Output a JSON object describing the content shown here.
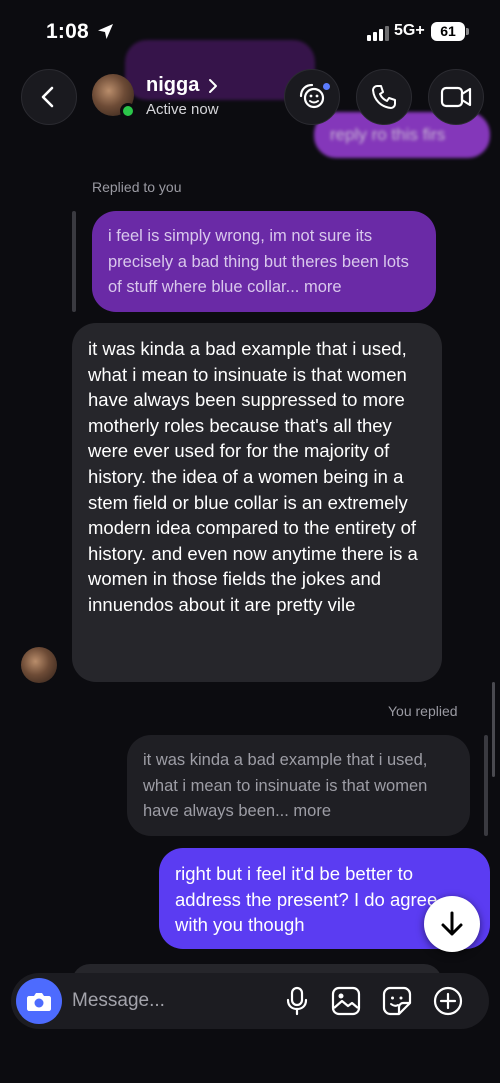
{
  "status_bar": {
    "time": "1:08",
    "network": "5G+",
    "battery": "61"
  },
  "header": {
    "contact_name": "nigga",
    "status": "Active now"
  },
  "background_preview": {
    "blurred_text": "reply ro this firs"
  },
  "messages": {
    "replied_to_you_label": "Replied to you",
    "quoted_from_me": "i feel is simply wrong, im not sure its precisely a bad thing but theres been lots of stuff where blue collar... more",
    "incoming": "it was kinda a bad example that i used, what i mean to insinuate is that women have always been suppressed to more motherly roles because that's all they were ever used for for the majority of history. the idea of a women being in a stem field or blue collar is an extremely modern idea compared to the entirety of history. and even now anytime there is a women in those fields the jokes and innuendos about it are pretty vile",
    "you_replied_label": "You replied",
    "quoted_from_them": "it was kinda a bad example that i used, what i mean to insinuate is that women have always been... more",
    "outgoing": "right but i feel it'd be better to address the present? I do agree with you though"
  },
  "composer": {
    "placeholder": "Message..."
  },
  "colors": {
    "outgoing_bubble": "#5b3cf2",
    "quoted_purple": "#6a2aa6",
    "incoming_bubble": "#26262b",
    "online": "#2bc64a",
    "camera_button": "#4d6bfe"
  },
  "icons": [
    "location-arrow-icon",
    "chevron-left-icon",
    "chevron-right-icon",
    "effects-icon",
    "phone-icon",
    "video-icon",
    "camera-icon",
    "microphone-icon",
    "gallery-icon",
    "sticker-icon",
    "plus-icon",
    "arrow-down-icon"
  ]
}
